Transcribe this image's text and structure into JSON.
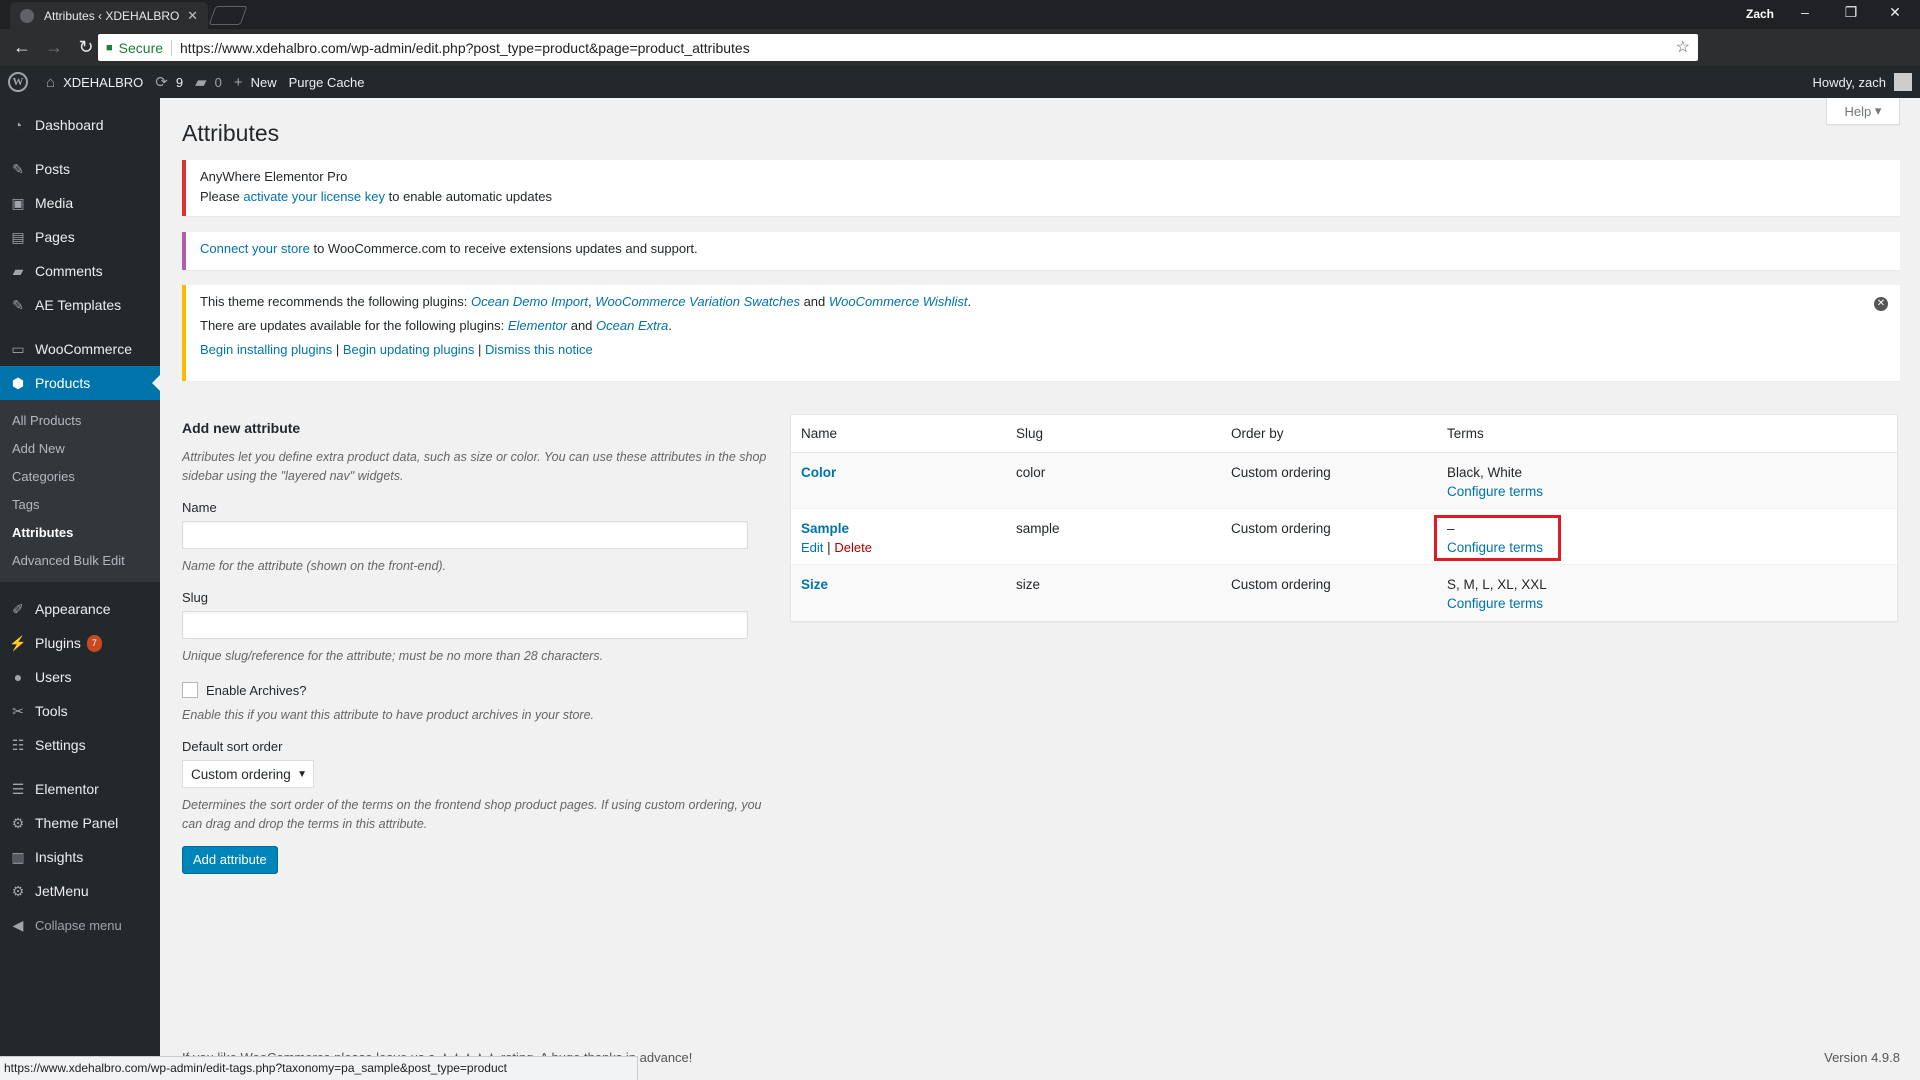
{
  "browser": {
    "tab_title": "Attributes ‹ XDEHALBRO",
    "profile": "Zach",
    "url_secure": "Secure",
    "url": "https://www.xdehalbro.com/wp-admin/edit.php?post_type=product&page=product_attributes",
    "status_url": "https://www.xdehalbro.com/wp-admin/edit-tags.php?taxonomy=pa_sample&post_type=product"
  },
  "adminbar": {
    "site": "XDEHALBRO",
    "updates": "9",
    "comments": "0",
    "new": "New",
    "purge": "Purge Cache",
    "howdy": "Howdy, zach"
  },
  "sidebar": {
    "dashboard": "Dashboard",
    "posts": "Posts",
    "media": "Media",
    "pages": "Pages",
    "comments": "Comments",
    "ae_templates": "AE Templates",
    "woocommerce": "WooCommerce",
    "products": "Products",
    "sub": [
      "All Products",
      "Add New",
      "Categories",
      "Tags",
      "Attributes",
      "Advanced Bulk Edit"
    ],
    "appearance": "Appearance",
    "plugins": "Plugins",
    "plugins_badge": "7",
    "users": "Users",
    "tools": "Tools",
    "settings": "Settings",
    "elementor": "Elementor",
    "theme_panel": "Theme Panel",
    "insights": "Insights",
    "jetmenu": "JetMenu",
    "collapse": "Collapse menu"
  },
  "page": {
    "title": "Attributes",
    "help": "Help",
    "version": "Version 4.9.8",
    "footer": "If you like WooCommerce please leave us a ★★★★★ rating. A huge thanks in advance!"
  },
  "notices": {
    "n1_title": "AnyWhere Elementor Pro",
    "n1_pre": "Please ",
    "n1_link": "activate your license key",
    "n1_post": " to enable automatic updates",
    "n2_link": "Connect your store",
    "n2_post": " to WooCommerce.com to receive extensions updates and support.",
    "n3_l1_pre": "This theme recommends the following plugins: ",
    "n3_p1": "Ocean Demo Import",
    "n3_p2": "WooCommerce Variation Swatches",
    "n3_and": " and ",
    "n3_p3": "WooCommerce Wishlist",
    "n3_l2_pre": "There are updates available for the following plugins: ",
    "n3_u1": "Elementor",
    "n3_u2": "Ocean Extra",
    "n3_a1": "Begin installing plugins",
    "n3_a2": "Begin updating plugins",
    "n3_a3": "Dismiss this notice"
  },
  "form": {
    "heading": "Add new attribute",
    "intro": "Attributes let you define extra product data, such as size or color. You can use these attributes in the shop sidebar using the \"layered nav\" widgets.",
    "name_label": "Name",
    "name_value": "",
    "name_desc": "Name for the attribute (shown on the front-end).",
    "slug_label": "Slug",
    "slug_value": "",
    "slug_desc": "Unique slug/reference for the attribute; must be no more than 28 characters.",
    "archives_label": "Enable Archives?",
    "archives_desc": "Enable this if you want this attribute to have product archives in your store.",
    "sort_label": "Default sort order",
    "sort_value": "Custom ordering",
    "sort_desc": "Determines the sort order of the terms on the frontend shop product pages. If using custom ordering, you can drag and drop the terms in this attribute.",
    "submit": "Add attribute"
  },
  "table": {
    "headers": [
      "Name",
      "Slug",
      "Order by",
      "Terms"
    ],
    "rows": [
      {
        "name": "Color",
        "slug": "color",
        "order": "Custom ordering",
        "terms": "Black, White",
        "configure": "Configure terms"
      },
      {
        "name": "Sample",
        "slug": "sample",
        "order": "Custom ordering",
        "terms": "–",
        "configure": "Configure terms",
        "edit": "Edit",
        "delete": "Delete"
      },
      {
        "name": "Size",
        "slug": "size",
        "order": "Custom ordering",
        "terms": "S, M, L, XL, XXL",
        "configure": "Configure terms"
      }
    ]
  }
}
